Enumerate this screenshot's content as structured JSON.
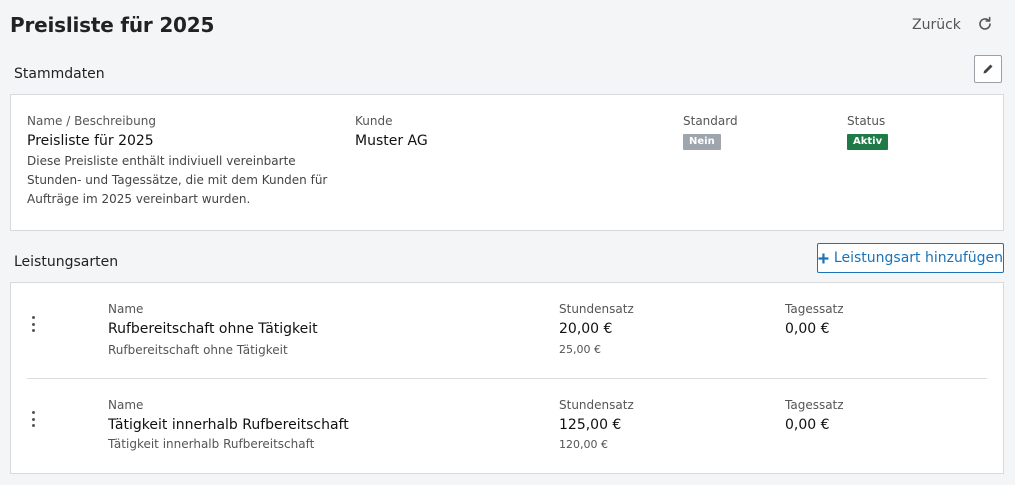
{
  "header": {
    "title": "Preisliste für 2025",
    "back_label": "Zurück",
    "refresh_icon": "refresh-icon"
  },
  "stammdaten": {
    "section_title": "Stammdaten",
    "edit_icon": "pencil-icon",
    "name_label": "Name / Beschreibung",
    "name_value": "Preisliste für 2025",
    "description": "Diese Preisliste enthält indiviuell vereinbarte Stunden- und Tagessätze, die mit dem Kunden für Aufträge im 2025 vereinbart wurden.",
    "kunde_label": "Kunde",
    "kunde_value": "Muster AG",
    "standard_label": "Standard",
    "standard_badge": "Nein",
    "status_label": "Status",
    "status_badge": "Aktiv",
    "colors": {
      "standard_badge_bg": "#9ea5ad",
      "status_badge_bg": "#1e7a46"
    }
  },
  "leistungsarten": {
    "section_title": "Leistungsarten",
    "add_label": "Leistungsart hinzufügen",
    "add_icon": "plus-icon",
    "accent": "#1a73b8",
    "col_name": "Name",
    "col_stundensatz": "Stundensatz",
    "col_tagessatz": "Tagessatz",
    "rows": [
      {
        "name": "Rufbereitschaft ohne Tätigkeit",
        "sub": "Rufbereitschaft ohne Tätigkeit",
        "stundensatz": "20,00 €",
        "stundensatz_sub": "25,00 €",
        "tagessatz": "0,00 €"
      },
      {
        "name": "Tätigkeit innerhalb Rufbereitschaft",
        "sub": "Tätigkeit innerhalb Rufbereitschaft",
        "stundensatz": "125,00 €",
        "stundensatz_sub": "120,00 €",
        "tagessatz": "0,00 €"
      }
    ]
  }
}
